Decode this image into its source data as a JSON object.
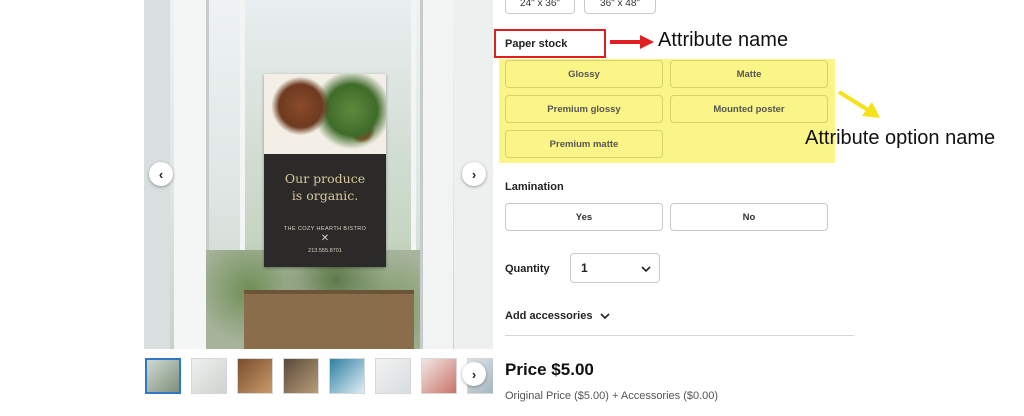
{
  "sizes": [
    "24\" x 36\"",
    "36\" x 48\""
  ],
  "poster": {
    "headline_1": "Our produce",
    "headline_2": "is organic.",
    "business": "THE COZY HEARTH BISTRO",
    "phone": "213.555.8701"
  },
  "thumbnail_count": 8,
  "paper_stock": {
    "label": "Paper stock",
    "options": [
      "Glossy",
      "Matte",
      "Premium glossy",
      "Mounted poster",
      "Premium matte"
    ]
  },
  "lamination": {
    "label": "Lamination",
    "options": [
      "Yes",
      "No"
    ]
  },
  "quantity": {
    "label": "Quantity",
    "value": "1"
  },
  "accessories": {
    "label": "Add accessories"
  },
  "price": {
    "text": "Price $5.00",
    "breakdown": "Original Price ($5.00) + Accessories ($0.00)"
  },
  "annotations": {
    "attribute_name": "Attribute name",
    "attribute_option_name": "Attribute option name"
  },
  "colors": {
    "highlight": "#fbf587",
    "annotation_red": "#e02020",
    "annotation_yellow": "#f5e21a",
    "thumb_active": "#2e78c7"
  },
  "icons": {
    "gallery_prev": "chevron-left-icon",
    "gallery_next": "chevron-right-icon",
    "quantity": "chevron-down-icon",
    "accessories": "chevron-down-icon"
  }
}
